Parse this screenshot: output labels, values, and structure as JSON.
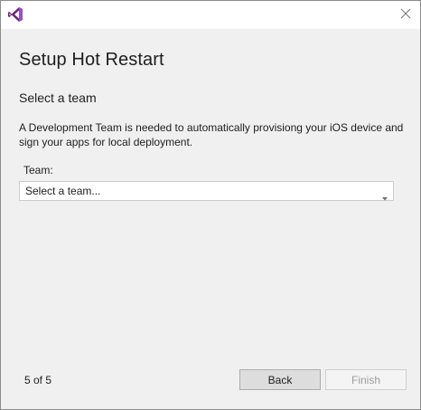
{
  "window": {
    "icons": {
      "logo": "visual-studio-logo-icon",
      "close": "close-icon"
    }
  },
  "page": {
    "title": "Setup Hot Restart",
    "section_heading": "Select a team",
    "description": "A Development Team is needed to automatically provisiong your iOS device and sign your apps for local deployment."
  },
  "team": {
    "label": "Team:",
    "selected": "Select a team...",
    "dropdown_icon": "chevron-down-icon"
  },
  "footer": {
    "step": "5 of 5",
    "back_label": "Back",
    "finish_label": "Finish",
    "finish_enabled": false
  },
  "colors": {
    "brand": "#68217a",
    "brand_light": "#9b4dca",
    "background": "#f0f0f0",
    "disabled_text": "#9d9d9d"
  }
}
